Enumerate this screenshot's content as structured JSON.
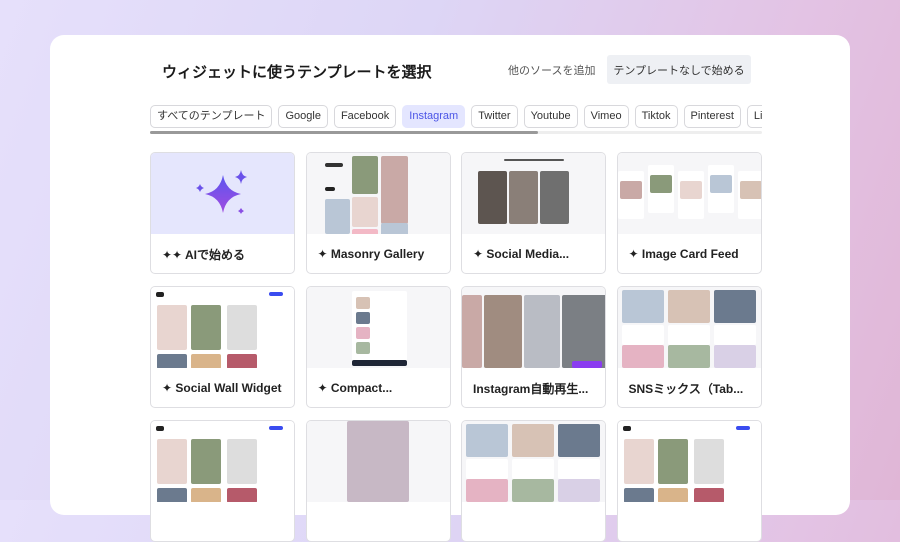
{
  "header": {
    "title": "ウィジェットに使うテンプレートを選択",
    "add_source": "他のソースを追加",
    "start_without": "テンプレートなしで始める"
  },
  "tabs": [
    "すべてのテンプレート",
    "Google",
    "Facebook",
    "Instagram",
    "Twitter",
    "Youtube",
    "Vimeo",
    "Tiktok",
    "Pinterest",
    "Linkedin"
  ],
  "active_tab": "Instagram",
  "templates": [
    {
      "label": "✦✦ AIで始める",
      "thumb": "ai"
    },
    {
      "label": "✦ Masonry Gallery",
      "thumb": "masonry"
    },
    {
      "label": "✦ Social Media...",
      "thumb": "cards"
    },
    {
      "label": "✦ Image Card Feed",
      "thumb": "feed"
    },
    {
      "label": "✦ Social Wall Widget",
      "thumb": "wall"
    },
    {
      "label": "✦ Compact...",
      "thumb": "compact"
    },
    {
      "label": "Instagram自動再生...",
      "thumb": "reels"
    },
    {
      "label": "SNSミックス（Tab...",
      "thumb": "mix"
    },
    {
      "label": "",
      "thumb": "wall"
    },
    {
      "label": "",
      "thumb": "single"
    },
    {
      "label": "",
      "thumb": "mix2"
    },
    {
      "label": "",
      "thumb": "wall"
    }
  ]
}
